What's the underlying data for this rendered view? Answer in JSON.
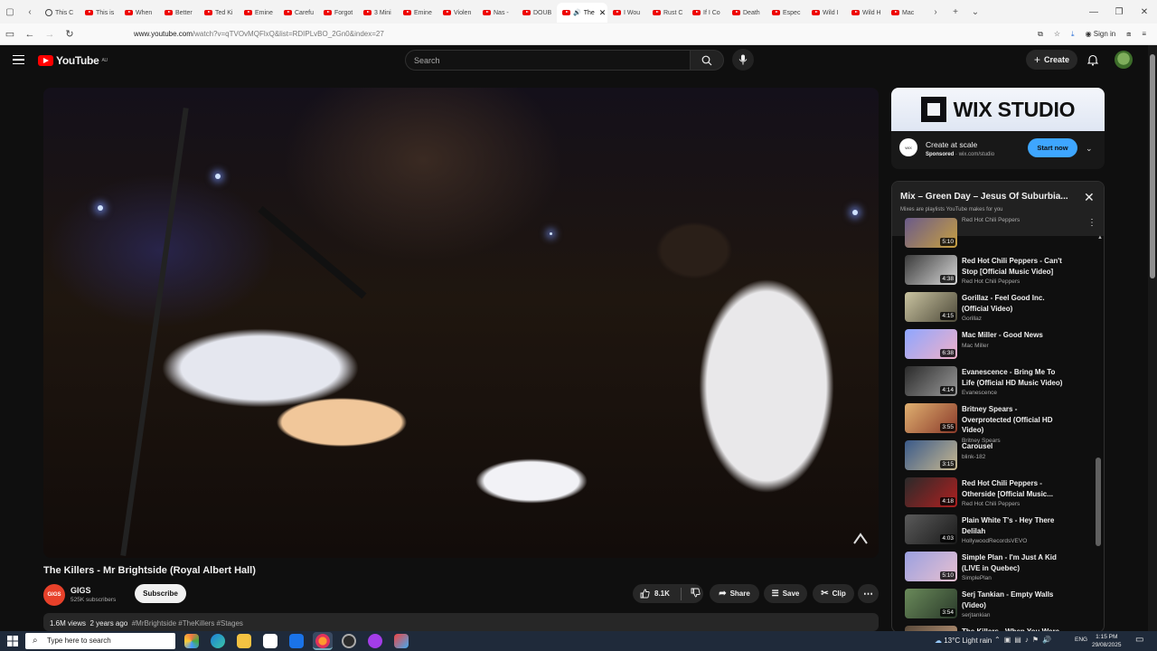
{
  "browser": {
    "tabs": [
      {
        "label": "This C",
        "icon": "clock"
      },
      {
        "label": "This is",
        "icon": "youtube"
      },
      {
        "label": "When",
        "icon": "youtube"
      },
      {
        "label": "Better",
        "icon": "youtube"
      },
      {
        "label": "Ted Ki",
        "icon": "youtube"
      },
      {
        "label": "Emine",
        "icon": "youtube"
      },
      {
        "label": "Carefu",
        "icon": "youtube"
      },
      {
        "label": "Forgot",
        "icon": "youtube"
      },
      {
        "label": "3 Mini",
        "icon": "youtube"
      },
      {
        "label": "Emine",
        "icon": "youtube"
      },
      {
        "label": "Violen",
        "icon": "youtube"
      },
      {
        "label": "Nas -",
        "icon": "youtube"
      },
      {
        "label": "DOUB",
        "icon": "youtube"
      },
      {
        "label": "The",
        "icon": "youtube",
        "active": true
      },
      {
        "label": "I Wou",
        "icon": "youtube"
      },
      {
        "label": "Rust C",
        "icon": "youtube"
      },
      {
        "label": "If I Co",
        "icon": "youtube"
      },
      {
        "label": "Death",
        "icon": "youtube"
      },
      {
        "label": "Espec",
        "icon": "youtube"
      },
      {
        "label": "Wild I",
        "icon": "youtube"
      },
      {
        "label": "Wild H",
        "icon": "youtube"
      },
      {
        "label": "Mac",
        "icon": "youtube"
      }
    ],
    "url_host": "www.youtube.com",
    "url_path": "/watch?v=qTVOvMQFlxQ&list=RDIPLvBO_2Gn0&index=27",
    "sign_in": "Sign in"
  },
  "header": {
    "logo_text": "YouTube",
    "logo_region": "AU",
    "search_placeholder": "Search",
    "create_label": "Create"
  },
  "video": {
    "title": "The Killers - Mr Brightside (Royal Albert Hall)",
    "channel_name": "GIGS",
    "channel_avatar_text": "GIGS",
    "subscribers": "525K subscribers",
    "subscribe_label": "Subscribe",
    "likes": "8.1K",
    "share_label": "Share",
    "save_label": "Save",
    "clip_label": "Clip",
    "views": "1.6M views",
    "age": "2 years ago",
    "hashtags": "#MrBrightside #TheKillers #Stages"
  },
  "ad": {
    "banner_text": "WIX STUDIO",
    "title": "Create at scale",
    "sponsored": "Sponsored",
    "domain": "wix.com/studio",
    "cta": "Start now"
  },
  "playlist": {
    "title": "Mix – Green Day – Jesus Of Suburbia...",
    "subtitle": "Mixes are playlists YouTube makes for you",
    "items": [
      {
        "title": "",
        "channel": "Red Hot Chili Peppers",
        "duration": "5:10",
        "thumb": [
          "#6a5a8a",
          "#c8a040"
        ]
      },
      {
        "title": "Red Hot Chili Peppers - Can't Stop [Official Music Video]",
        "channel": "Red Hot Chili Peppers",
        "duration": "4:38",
        "thumb": [
          "#3a3a3a",
          "#d8d8d8"
        ]
      },
      {
        "title": "Gorillaz - Feel Good Inc. (Official Video)",
        "channel": "Gorillaz",
        "duration": "4:15",
        "thumb": [
          "#c9c3a0",
          "#4e4a3a"
        ]
      },
      {
        "title": "Mac Miller - Good News",
        "channel": "Mac Miller",
        "duration": "6:38",
        "thumb": [
          "#8ea6ff",
          "#f0b0c8"
        ]
      },
      {
        "title": "Evanescence - Bring Me To Life (Official HD Music Video)",
        "channel": "Evanescence",
        "duration": "4:14",
        "thumb": [
          "#2a2a2a",
          "#9a9a9a"
        ]
      },
      {
        "title": "Britney Spears - Overprotected (Official HD Video)",
        "channel": "Britney Spears",
        "duration": "3:55",
        "thumb": [
          "#e0b070",
          "#8a3a2a"
        ]
      },
      {
        "title": "Carousel",
        "channel": "blink-182",
        "duration": "3:15",
        "thumb": [
          "#3a5a8a",
          "#c8b890"
        ]
      },
      {
        "title": "Red Hot Chili Peppers - Otherside [Official Music...",
        "channel": "Red Hot Chili Peppers",
        "duration": "4:18",
        "thumb": [
          "#2a2a2a",
          "#b02020"
        ]
      },
      {
        "title": "Plain White T's - Hey There Delilah",
        "channel": "HollywoodRecordsVEVO",
        "duration": "4:03",
        "thumb": [
          "#5a5a5a",
          "#1a1a1a"
        ]
      },
      {
        "title": "Simple Plan - I'm Just A Kid (LIVE in Quebec)",
        "channel": "SimplePlan",
        "duration": "5:10",
        "thumb": [
          "#9aa0e0",
          "#e8c0d0"
        ]
      },
      {
        "title": "Serj Tankian - Empty Walls (Video)",
        "channel": "serjtankian",
        "duration": "3:54",
        "thumb": [
          "#6a8a5a",
          "#2a3a2a"
        ]
      },
      {
        "title": "The Killers - When You Were",
        "channel": "",
        "duration": "",
        "thumb": [
          "#5a4a3a",
          "#c8a080"
        ]
      }
    ]
  },
  "taskbar": {
    "search_placeholder": "Type here to search",
    "weather": "13°C  Light rain",
    "language": "ENG",
    "time": "1:15 PM",
    "date": "29/08/2025"
  }
}
